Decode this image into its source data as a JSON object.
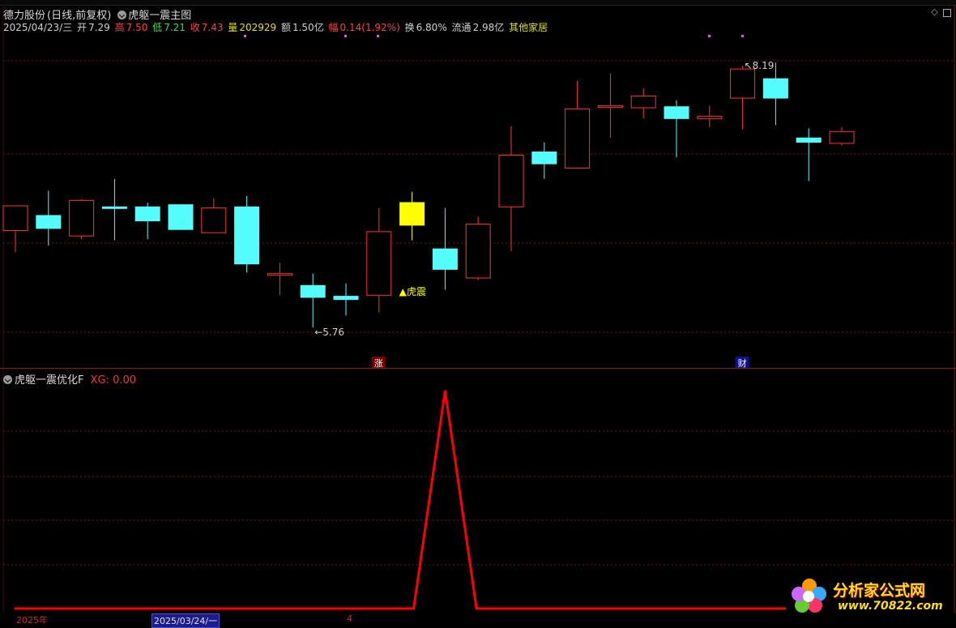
{
  "header": {
    "stock_name": "德力股份",
    "period_mode": "(日线,前复权)",
    "indicator_main": "虎躯一震主图",
    "date": "2025/04/23/三",
    "open_label": "开",
    "open_value": "7.29",
    "high_label": "高",
    "high_value": "7.50",
    "low_label": "低",
    "low_value": "7.21",
    "close_label": "收",
    "close_value": "7.43",
    "volume_label": "量",
    "volume_value": "202929",
    "amount_label": "额",
    "amount_value": "1.50亿",
    "change_label": "幅",
    "change_value": "0.14(1.92%)",
    "turnover_label": "换",
    "turnover_value": "6.80%",
    "float_label": "流通",
    "float_value": "2.98亿",
    "sector": "其他家居"
  },
  "chart_annotations": {
    "low_label": "5.76",
    "high_label": "8.19",
    "signal_text": "▲虎震",
    "marker_zhang": "涨",
    "marker_cai": "财"
  },
  "subpanel": {
    "indicator_name": "虎躯一震优化F",
    "xg_label": "XG: 0.00"
  },
  "bottom": {
    "year": "2025年",
    "date_box": "2025/03/24/一",
    "marker": "4"
  },
  "watermark": {
    "text": "分析家公式网",
    "url": "www.70822.com"
  },
  "colors": {
    "up": "#ff3232",
    "down": "#54fcfc",
    "signal": "#ffff00",
    "grid": "#7a1010",
    "line": "#ff0000"
  },
  "chart_data": {
    "type": "candlestick",
    "candles": [
      {
        "o": 6.66,
        "h": 6.78,
        "l": 6.46,
        "c": 6.89
      },
      {
        "o": 6.8,
        "h": 7.03,
        "l": 6.52,
        "c": 6.68
      },
      {
        "o": 6.61,
        "h": 6.95,
        "l": 6.58,
        "c": 6.94
      },
      {
        "o": 6.88,
        "h": 7.14,
        "l": 6.57,
        "c": 6.87
      },
      {
        "o": 6.88,
        "h": 6.92,
        "l": 6.58,
        "c": 6.75
      },
      {
        "o": 6.9,
        "h": 6.9,
        "l": 6.67,
        "c": 6.67
      },
      {
        "o": 6.64,
        "h": 6.96,
        "l": 6.64,
        "c": 6.87
      },
      {
        "o": 6.88,
        "h": 6.98,
        "l": 6.27,
        "c": 6.35
      },
      {
        "o": 6.26,
        "h": 6.36,
        "l": 6.06,
        "c": 6.26
      },
      {
        "o": 6.15,
        "h": 6.26,
        "l": 5.76,
        "c": 6.04
      },
      {
        "o": 6.05,
        "h": 6.17,
        "l": 5.87,
        "c": 6.02
      },
      {
        "o": 6.06,
        "h": 6.87,
        "l": 5.9,
        "c": 6.65
      },
      {
        "o": 6.71,
        "h": 7.02,
        "l": 6.57,
        "c": 6.92
      },
      {
        "o": 6.49,
        "h": 6.87,
        "l": 6.11,
        "c": 6.3
      },
      {
        "o": 6.22,
        "h": 6.79,
        "l": 6.2,
        "c": 6.72
      },
      {
        "o": 6.88,
        "h": 7.63,
        "l": 6.47,
        "c": 7.36
      },
      {
        "o": 7.39,
        "h": 7.48,
        "l": 7.14,
        "c": 7.28
      },
      {
        "o": 7.24,
        "h": 8.05,
        "l": 7.24,
        "c": 7.79
      },
      {
        "o": 7.81,
        "h": 8.12,
        "l": 7.52,
        "c": 7.82
      },
      {
        "o": 7.8,
        "h": 7.98,
        "l": 7.7,
        "c": 7.91
      },
      {
        "o": 7.81,
        "h": 7.87,
        "l": 7.34,
        "c": 7.7
      },
      {
        "o": 7.7,
        "h": 7.82,
        "l": 7.62,
        "c": 7.72
      },
      {
        "o": 7.89,
        "h": 8.19,
        "l": 7.6,
        "c": 8.16
      },
      {
        "o": 8.07,
        "h": 8.22,
        "l": 7.64,
        "c": 7.89
      },
      {
        "o": 7.52,
        "h": 7.61,
        "l": 7.12,
        "c": 7.48
      },
      {
        "o": 7.47,
        "h": 7.62,
        "l": 7.45,
        "c": 7.58
      }
    ],
    "signal_index": 12,
    "subpanel_values": [
      0,
      0,
      0,
      0,
      0,
      0,
      0,
      0,
      0,
      0,
      0,
      0,
      0,
      1,
      0,
      0,
      0,
      0,
      0,
      0,
      0,
      0,
      0,
      0,
      0,
      0
    ]
  }
}
